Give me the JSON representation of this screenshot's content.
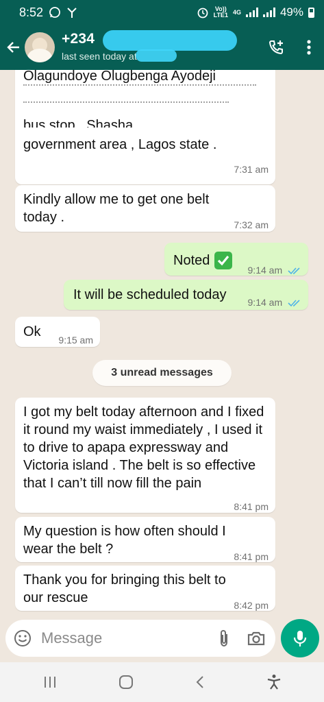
{
  "status_bar": {
    "time": "8:52",
    "volte_line1": "Vo))",
    "volte_line2": "LTE1",
    "network": "4G",
    "battery": "49%"
  },
  "header": {
    "contact_name": "+234",
    "subtitle": "last seen today at"
  },
  "messages": [
    {
      "direction": "in",
      "text": "Olagundoye Olugbenga Ayodeji",
      "time": ""
    },
    {
      "direction": "in",
      "text": "bus stop , Shasha ,",
      "time": ""
    },
    {
      "direction": "in",
      "text": "government area , Lagos state .",
      "time": "7:31 am"
    },
    {
      "direction": "in",
      "text": "Kindly allow me to get one belt today .",
      "time": "7:32 am"
    },
    {
      "direction": "out",
      "text": "Noted",
      "time": "9:14 am",
      "status": "read"
    },
    {
      "direction": "out",
      "text": "It will be scheduled today",
      "time": "9:14 am",
      "status": "read"
    },
    {
      "direction": "in",
      "text": "Ok",
      "time": "9:15 am"
    },
    {
      "direction": "in",
      "text": "I got my belt today afternoon and I fixed it round my waist immediately , I used it to drive to apapa expressway and Victoria island . The belt is so effective that I can’t till now fill the pain",
      "time": "8:41 pm"
    },
    {
      "direction": "in",
      "text": "My question is how often should I wear the belt ?",
      "time": "8:41 pm"
    },
    {
      "direction": "in",
      "text": "Thank you for bringing this belt to our rescue",
      "time": "8:42 pm"
    }
  ],
  "unread_label": "3 unread messages",
  "composer": {
    "placeholder": "Message"
  },
  "colors": {
    "header": "#075e54",
    "outgoing": "#dcf8c6",
    "incoming": "#ffffff",
    "read_ticks": "#4fb3e8",
    "mic": "#00a884",
    "check_emoji": "#3bb54a"
  },
  "icons": {
    "back": "arrow-left-icon",
    "call": "add-call-icon",
    "menu": "more-vertical-icon",
    "emoji": "smiley-icon",
    "attach": "paperclip-icon",
    "camera": "camera-icon",
    "mic": "microphone-icon"
  }
}
